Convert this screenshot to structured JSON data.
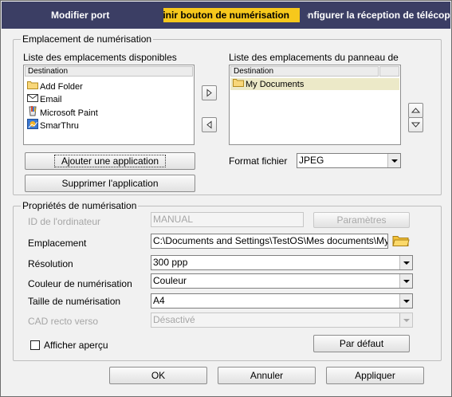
{
  "tabs": [
    {
      "label": "Modifier port"
    },
    {
      "label": "Définir bouton de numérisation"
    },
    {
      "label": "Configurer la réception de télécopie"
    }
  ],
  "scan_location": {
    "group_label": "Emplacement de numérisation",
    "available_label": "Liste des emplacements disponibles",
    "panel_label": "Liste des emplacements du panneau de commande",
    "available_header": "Destination",
    "available_items": [
      {
        "label": "Add Folder",
        "icon": "folder-icon"
      },
      {
        "label": "Email",
        "icon": "email-icon"
      },
      {
        "label": "Microsoft Paint",
        "icon": "paint-icon"
      },
      {
        "label": "SmarThru",
        "icon": "smarthru-icon"
      }
    ],
    "panel_header": "Destination",
    "panel_items": [
      {
        "label": "My Documents",
        "icon": "folder-icon"
      }
    ],
    "add_app_label": "Ajouter une application",
    "remove_app_label": "Supprimer l'application",
    "format_label": "Format fichier",
    "format_value": "JPEG"
  },
  "properties": {
    "group_label": "Propriétés de numérisation",
    "computer_id_label": "ID de l'ordinateur",
    "computer_id_value": "MANUAL",
    "params_label": "Paramètres",
    "location_label": "Emplacement",
    "location_value": "C:\\Documents and Settings\\TestOS\\Mes documents\\My",
    "resolution_label": "Résolution",
    "resolution_value": "300 ppp",
    "color_label": "Couleur de numérisation",
    "color_value": "Couleur",
    "size_label": "Taille de numérisation",
    "size_value": "A4",
    "duplex_label": "CAD recto verso",
    "duplex_value": "Désactivé",
    "preview_label": "Afficher aperçu",
    "default_label": "Par défaut"
  },
  "footer": {
    "ok_label": "OK",
    "cancel_label": "Annuler",
    "apply_label": "Appliquer"
  },
  "colors": {
    "tab_bar": "#3b3e64",
    "active_tab": "#f7c81c",
    "selection": "#ece9c8"
  }
}
